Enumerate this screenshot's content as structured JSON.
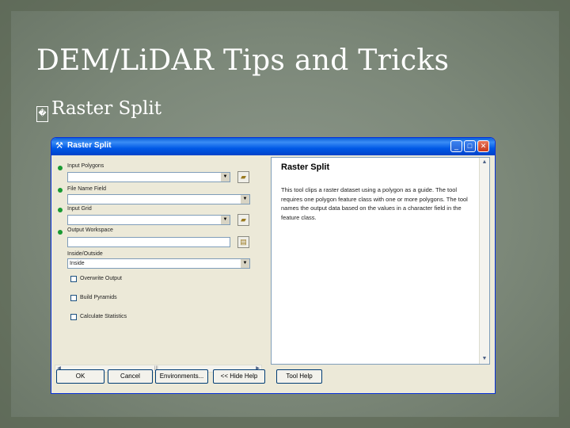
{
  "slide": {
    "title": "DEM/LiDAR Tips and Tricks",
    "bullet_mark": "�",
    "bullet": "Raster Split"
  },
  "window": {
    "title": "Raster Split",
    "app_icon": "toolbox-icon",
    "controls": [
      "_",
      "□",
      "✕"
    ]
  },
  "params": {
    "input_polygons": {
      "label": "Input Polygons",
      "value": ""
    },
    "file_name_field": {
      "label": "File Name Field",
      "value": ""
    },
    "input_grid": {
      "label": "Input Grid",
      "value": ""
    },
    "output_workspace": {
      "label": "Output Workspace",
      "value": ""
    },
    "inside_outside": {
      "label": "Inside/Outside",
      "value": "Inside"
    },
    "overwrite_output": "Overwrite Output",
    "build_pyramids": "Build Pyramids",
    "calculate_statistics": "Calculate Statistics"
  },
  "help": {
    "heading": "Raster Split",
    "body": "This tool clips a raster dataset using a polygon as a guide. The tool requires one polygon feature class with one or more polygons. The tool names the output data based on the values in a character field in the feature class."
  },
  "buttons": {
    "ok": "OK",
    "cancel": "Cancel",
    "environments": "Environments...",
    "hide_help": "<< Hide Help",
    "tool_help": "Tool Help"
  },
  "scroll_glyphs": {
    "up": "▲",
    "down": "▼",
    "left": "◀",
    "right": "▶",
    "grip": "|||"
  },
  "colors": {
    "titlebar": "#0058e6",
    "required_dot": "#1a9a32",
    "dialog_bg": "#ece9d8"
  }
}
